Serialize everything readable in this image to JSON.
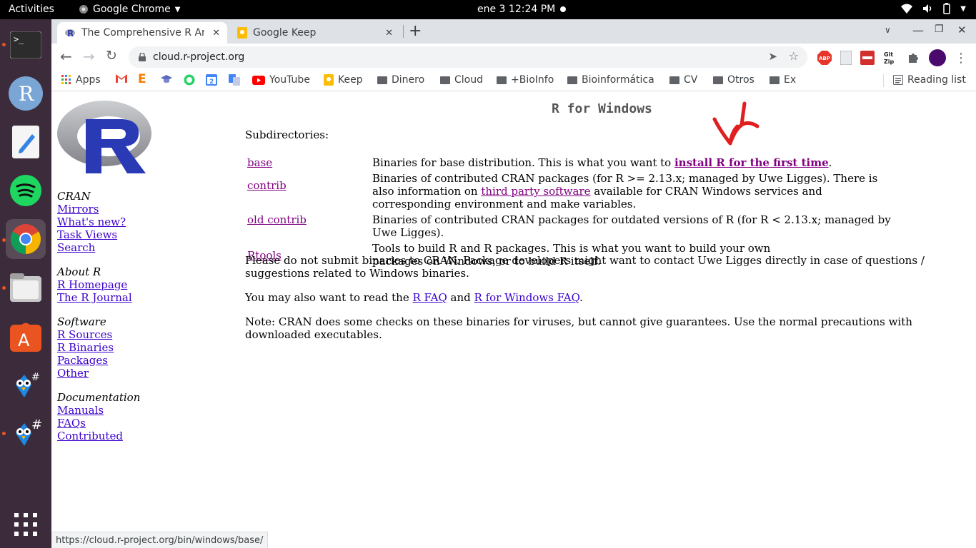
{
  "topbar": {
    "activities": "Activities",
    "app_name": "Google Chrome",
    "clock": "ene 3  12:24 PM"
  },
  "dock": {
    "items": [
      "terminal",
      "r-app",
      "text-editor",
      "spotify",
      "google-chrome",
      "files",
      "ubuntu-software",
      "bird-app-1",
      "bird-app-2"
    ],
    "show_apps": "show-applications"
  },
  "browser": {
    "tabs": [
      {
        "title": "The Comprehensive R Archi",
        "active": true
      },
      {
        "title": "Google Keep",
        "active": false
      }
    ],
    "url": "cloud.r-project.org",
    "bookmarks": [
      "Apps",
      "YouTube",
      "Keep",
      "Dinero",
      "Cloud",
      "+BioInfo",
      "Bioinformática",
      "CV",
      "Otros",
      "Ex"
    ],
    "reading_list": "Reading list",
    "status_url": "https://cloud.r-project.org/bin/windows/base/"
  },
  "sidebar": {
    "cran_heading": "CRAN",
    "cran_links": [
      "Mirrors",
      "What's new?",
      "Task Views",
      "Search"
    ],
    "about_heading": "About R",
    "about_links": [
      "R Homepage",
      "The R Journal"
    ],
    "software_heading": "Software",
    "software_links": [
      "R Sources",
      "R Binaries",
      "Packages",
      "Other"
    ],
    "docs_heading": "Documentation",
    "docs_links": [
      "Manuals",
      "FAQs",
      "Contributed"
    ]
  },
  "main": {
    "title": "R for Windows",
    "subdirs_label": "Subdirectories:",
    "rows": [
      {
        "link": "base",
        "desc_pre": "Binaries for base distribution. This is what you want to ",
        "desc_link": "install R for the first time",
        "desc_post": "."
      },
      {
        "link": "contrib",
        "desc_pre": "Binaries of contributed CRAN packages (for R >= 2.13.x; managed by Uwe Ligges). There is also information on ",
        "desc_link": "third party software",
        "desc_post": " available for CRAN Windows services and corresponding environment and make variables."
      },
      {
        "link": "old contrib",
        "desc_pre": "Binaries of contributed CRAN packages for outdated versions of R (for R < 2.13.x; managed by Uwe Ligges).",
        "desc_link": "",
        "desc_post": ""
      },
      {
        "link": "Rtools",
        "desc_pre": "Tools to build R and R packages. This is what you want to build your own packages on Windows, or to build R itself.",
        "desc_link": "",
        "desc_post": ""
      }
    ],
    "para1": "Please do not submit binaries to CRAN. Package developers might want to contact Uwe Ligges directly in case of questions / suggestions related to Windows binaries.",
    "para2_pre": "You may also want to read the ",
    "para2_link1": "R FAQ",
    "para2_mid": " and ",
    "para2_link2": "R for Windows FAQ",
    "para2_post": ".",
    "para3": "Note: CRAN does some checks on these binaries for viruses, but cannot give guarantees. Use the normal precautions with downloaded executables."
  },
  "colors": {
    "link": "#3a00cc",
    "visited": "#800080",
    "annotation": "#e02020",
    "dock": "#3c2b3a"
  }
}
